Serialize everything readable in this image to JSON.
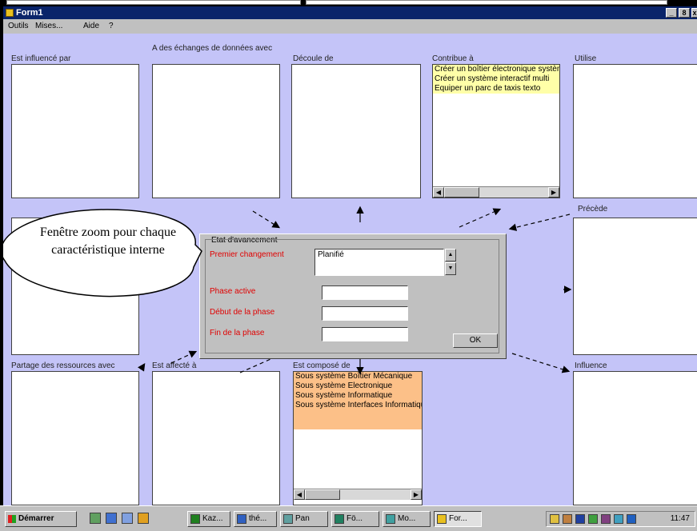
{
  "window": {
    "title": "Form1",
    "controls": {
      "minimize": "_",
      "maximize": "8",
      "close": "x"
    }
  },
  "menu": [
    "Outils",
    "Mises...",
    "Aide",
    "?"
  ],
  "panels": {
    "influence_par": "Est influencé par",
    "echange": "A des échanges de données avec",
    "decoule": "Découle de",
    "contribue": "Contribue à",
    "utilise": "Utilise",
    "precede": "Précède",
    "partage": "Partage des ressources avec",
    "est_affecte": "Est affecté à",
    "compose": "Est composé de",
    "influence": "Influence"
  },
  "contribue_items": [
    "Créer un boîtier électronique système",
    "Créer un système interactif multi",
    "Equiper un parc de taxis texto"
  ],
  "compose_items": [
    "Sous système Boîtier Mécanique",
    "Sous système Electronique",
    "Sous système Informatique",
    "Sous système Interfaces Informatique"
  ],
  "zoom": {
    "legend": "Etat d'avancement",
    "premier_label": "Premier changement",
    "premier_value": "Planifié",
    "phase_label": "Phase active",
    "debut_label": "Début de la phase",
    "fin_label": "Fin de la phase",
    "ok_label": "OK"
  },
  "callout": "Fenêtre zoom pour chaque caractéristique interne",
  "taskbar": {
    "start": "Démarrer",
    "buttons": [
      "Kaz...",
      "thé...",
      "Pan",
      "Fö...",
      "Mo...",
      "For..."
    ],
    "clock": "11:47"
  },
  "colors": {
    "canvas": "#c4c4f8",
    "list_yellow": "#ffffa8",
    "list_orange": "#fcc088",
    "label_red": "#e00000",
    "titlebar": "#0a246a"
  },
  "icons": [
    "app-icon",
    "start-flag-icon",
    "arrow-icon",
    "scroll-left-icon",
    "scroll-right-icon",
    "spin-up-icon",
    "spin-down-icon"
  ]
}
